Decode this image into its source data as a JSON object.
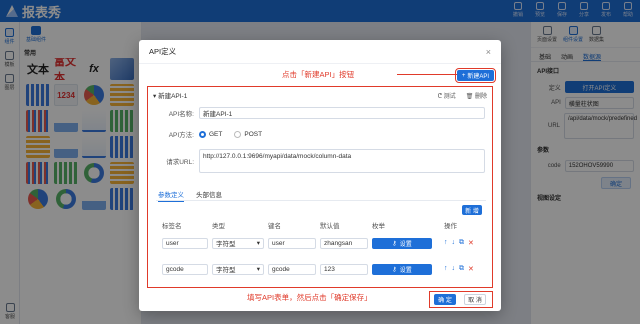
{
  "app": {
    "title": "报表秀",
    "accent": "#1e6fd8",
    "highlight": "#e03a2a"
  },
  "top_actions": [
    "撤销",
    "预览",
    "保存",
    "分享",
    "发布",
    "帮助"
  ],
  "rail": {
    "items": [
      {
        "label": "组件",
        "icon": "component-icon"
      },
      {
        "label": "模板",
        "icon": "template-icon"
      },
      {
        "label": "图层",
        "icon": "layer-icon"
      }
    ],
    "bottom": "客服"
  },
  "component_panel": {
    "tab_label": "基础组件",
    "section": "常用",
    "tiles": [
      "文本",
      "富文本",
      "fx",
      "图片",
      "1234"
    ]
  },
  "right_panel": {
    "icons": [
      "页面设置",
      "组件设置",
      "数据集"
    ],
    "tabs": [
      "基础",
      "动画",
      "数据源"
    ],
    "section_api": "API接口",
    "define_label": "定义",
    "open_api_button": "打开API定义",
    "api_label": "API",
    "api_value": "横量柱状图",
    "url_label": "URL",
    "url_value": "/api/data/mock/predefined",
    "params_section": "参数",
    "code_label": "code",
    "code_value": "152OHOV59990",
    "confirm": "确定",
    "view_settings": "视图设定"
  },
  "dialog": {
    "title": "API定义",
    "close_glyph": "×",
    "new_api_button": "新建API",
    "hint_top": "点击「新建API」按钮",
    "api_item": {
      "name": "新建API-1",
      "test_label": "测试",
      "delete_label": "删除",
      "name_label": "API名称:",
      "name_value": "新建API-1",
      "method_label": "API方法:",
      "method_options": [
        "GET",
        "POST"
      ],
      "method_selected": "GET",
      "url_label": "请求URL:",
      "url_value": "http://127.0.0.1:9696/myapi/data/mock/column-data",
      "tabs": [
        "参数定义",
        "头部信息"
      ],
      "add_button": "新 增",
      "columns": [
        "标签名",
        "类型",
        "键名",
        "默认值",
        "枚举",
        "操作"
      ],
      "rows": [
        {
          "label": "user",
          "type": "字符型",
          "key": "user",
          "default": "zhangsan",
          "enum": "设置"
        },
        {
          "label": "gcode",
          "type": "字符型",
          "key": "gcode",
          "default": "123",
          "enum": "设置"
        }
      ]
    },
    "hint_bottom": "填写API表单，然后点击「确定保存」",
    "ok_button": "确 定",
    "cancel_button": "取 消"
  }
}
